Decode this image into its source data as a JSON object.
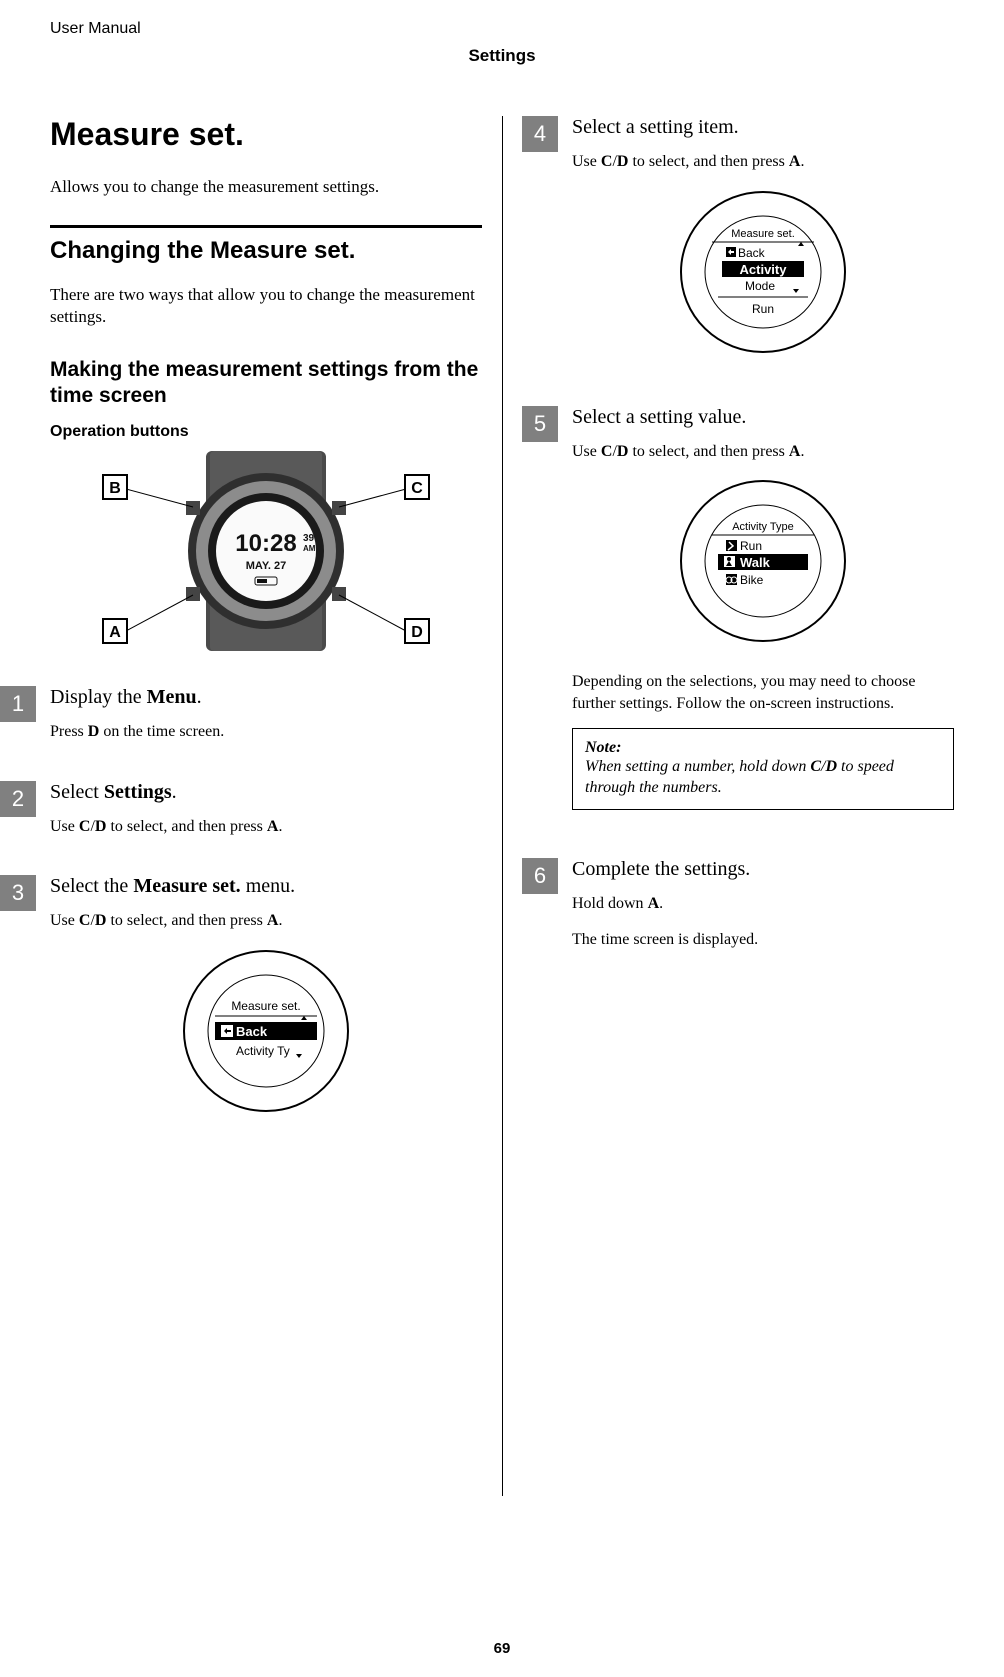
{
  "header": {
    "label": "User Manual",
    "chapter": "Settings"
  },
  "main_title": "Measure set.",
  "intro": "Allows you to change the measurement settings.",
  "section_title": "Changing the Measure set.",
  "section_intro": "There are two ways that allow you to change the measurement settings.",
  "subsection_title": "Making the measurement settings from the time screen",
  "op_buttons_label": "Operation buttons",
  "watch_figure": {
    "labels": {
      "A": "A",
      "B": "B",
      "C": "C",
      "D": "D"
    },
    "display": {
      "time": "10:28",
      "seconds": "39",
      "ampm": "AM",
      "date": "MAY. 27"
    }
  },
  "screen_step3": {
    "title": "Measure set.",
    "line1": "Back",
    "line2": "Activity Ty"
  },
  "screen_step4": {
    "title": "Measure set.",
    "line1": "Back",
    "line2": "Activity",
    "line3": "Mode",
    "footer": "Run"
  },
  "screen_step5": {
    "title": "Activity Type",
    "line1": "Run",
    "line2": "Walk",
    "line3": "Bike"
  },
  "steps": {
    "1": {
      "num": "1",
      "title_pre": "Display the ",
      "title_bold": "Menu",
      "title_post": ".",
      "desc_pre": "Press ",
      "desc_b1": "D",
      "desc_post": " on the time screen."
    },
    "2": {
      "num": "2",
      "title_pre": "Select ",
      "title_bold": "Settings",
      "title_post": ".",
      "desc_pre": "Use ",
      "desc_b1": "C",
      "desc_slash": "/",
      "desc_b2": "D",
      "desc_mid": " to select, and then press ",
      "desc_b3": "A",
      "desc_end": "."
    },
    "3": {
      "num": "3",
      "title_pre": "Select the ",
      "title_bold": "Measure set.",
      "title_post": " menu.",
      "desc_pre": "Use ",
      "desc_b1": "C",
      "desc_slash": "/",
      "desc_b2": "D",
      "desc_mid": " to select, and then press ",
      "desc_b3": "A",
      "desc_end": "."
    },
    "4": {
      "num": "4",
      "title": "Select a setting item.",
      "desc_pre": "Use ",
      "desc_b1": "C",
      "desc_slash": "/",
      "desc_b2": "D",
      "desc_mid": " to select, and then press ",
      "desc_b3": "A",
      "desc_end": "."
    },
    "5": {
      "num": "5",
      "title": "Select a setting value.",
      "desc_pre": "Use ",
      "desc_b1": "C",
      "desc_slash": "/",
      "desc_b2": "D",
      "desc_mid": " to select, and then press ",
      "desc_b3": "A",
      "desc_end": ".",
      "extra": "Depending on the selections, you may need to choose further settings. Follow the on-screen instructions."
    },
    "6": {
      "num": "6",
      "title": "Complete the settings.",
      "desc_pre": "Hold down ",
      "desc_b1": "A",
      "desc_end": ".",
      "extra": "The time screen is displayed."
    }
  },
  "note": {
    "label": "Note:",
    "text_pre": "When setting a number, hold down ",
    "text_b1": "C",
    "text_slash": "/",
    "text_b2": "D",
    "text_post": " to speed through the numbers."
  },
  "page_number": "69"
}
